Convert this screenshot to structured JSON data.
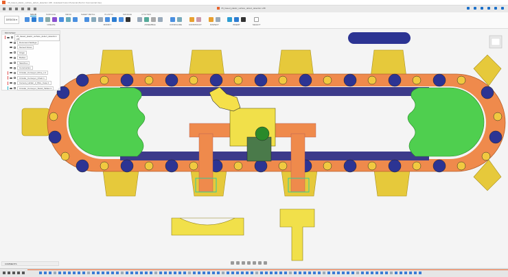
{
  "window": {
    "title": "V5_based_plastic_surface_defect_detection v98 - Autodesk Fusion Personal (Not for Commercial Use)"
  },
  "document_tab": {
    "label": "V5_based_plastic_surface_defect_detection v98"
  },
  "ribbon": {
    "workspace": "DESIGN",
    "tabs": [
      "SOLID",
      "SURFACE",
      "MESH",
      "SHEET METAL",
      "PLASTIC",
      "MANAGE",
      "UTILITIES"
    ],
    "groups": [
      "CREATE",
      "MODIFY",
      "ASSEMBLE",
      "CONFIGURE",
      "CONSTRUCT",
      "INSPECT",
      "INSERT",
      "SELECT"
    ]
  },
  "browser": {
    "header": "BROWSER",
    "items": [
      {
        "label": "V5_based_plastic_surface_defect_detection v98",
        "color": "#e05050"
      },
      {
        "label": "Document Settings"
      },
      {
        "label": "Named Views"
      },
      {
        "label": "Origin"
      },
      {
        "label": "Bodies"
      },
      {
        "label": "Sketches"
      },
      {
        "label": "Construction"
      },
      {
        "label": "Circular_Conveyor_Drive_1:1",
        "color": "#e05050"
      },
      {
        "label": "Circular_Conveyor_Chain:1",
        "color": "#e05050"
      },
      {
        "label": "Camera_Holder_2_Wire_Case:1",
        "color": "#e05050"
      },
      {
        "label": "Circular_Conveyor_Stand_Tables:1",
        "color": "#1ab0c8"
      }
    ]
  },
  "comments": {
    "label": "COMMENTS"
  },
  "colors": {
    "orange": "#ef8a4c",
    "green": "#4fcf4f",
    "yellow": "#f1e04a",
    "navy": "#2c3493",
    "accent": "#0696d7"
  }
}
